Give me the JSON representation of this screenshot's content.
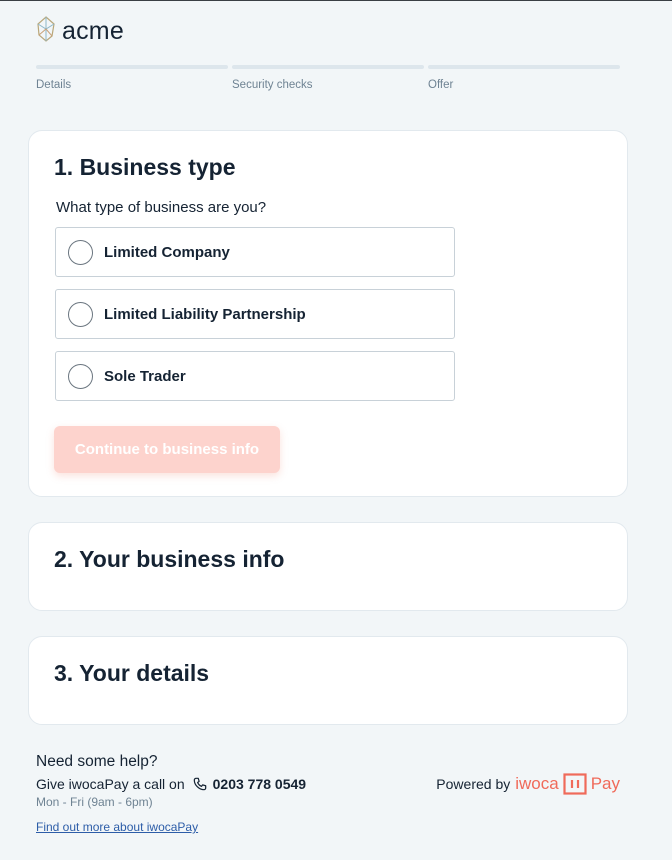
{
  "brand": {
    "logo_text": "acme"
  },
  "steps": [
    {
      "label": "Details"
    },
    {
      "label": "Security checks"
    },
    {
      "label": "Offer"
    }
  ],
  "section1": {
    "title": "1. Business type",
    "question": "What type of business are you?",
    "options": [
      {
        "label": "Limited Company"
      },
      {
        "label": "Limited Liability Partnership"
      },
      {
        "label": "Sole Trader"
      }
    ],
    "continue_label": "Continue to business info"
  },
  "section2": {
    "title": "2. Your business info"
  },
  "section3": {
    "title": "3. Your details"
  },
  "footer": {
    "help_title": "Need some help?",
    "call_text": "Give iwocaPay a call on",
    "phone": "0203 778 0549",
    "hours": "Mon - Fri (9am - 6pm)",
    "link": "Find out more about iwocaPay",
    "powered_by": "Powered by",
    "brand_left": "iwoca",
    "brand_right": "Pay"
  },
  "colors": {
    "accent": "#f06a5a",
    "button_disabled": "#fdd3cd",
    "background": "#f2f6f8",
    "text": "#152333"
  },
  "icons": {
    "logo": "acme-gem-icon",
    "phone": "phone-icon",
    "iwoca_mark": "iwoca-pay-mark-icon"
  }
}
